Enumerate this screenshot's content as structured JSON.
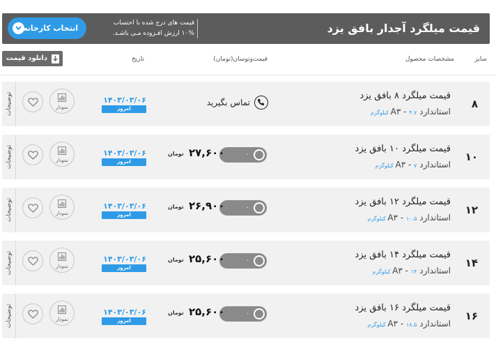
{
  "header": {
    "title": "قیمت میلگرد آجدار بافق یزد",
    "note_line1": "قیمت های درج شده با احتساب",
    "note_line2": "۱۰% ارزش افـزوده مـی باشـد.",
    "factory_button": "انتخاب کارخانه"
  },
  "toolbar": {
    "download_button": "دانلود قیمت"
  },
  "columns": {
    "size": "سایز",
    "specs": "مشخصات محصول",
    "price": "قیمت‌وتوسان(تومان)",
    "date": "تاریخ"
  },
  "labels": {
    "today": "امروز",
    "chart": "نمودار",
    "description": "توضیحات",
    "call": "تماس بگیرید",
    "currency": "تومان",
    "toggle_zero": "۰"
  },
  "rows": [
    {
      "size": "۸",
      "name": "قیمت میلگرد ۸ بافق یزد",
      "standard": "استاندارد A۳ - ",
      "weight": "۴.۷ کیلوگرم",
      "price": null,
      "call": true,
      "date": "۱۴۰۳/۰۳/۰۶"
    },
    {
      "size": "۱۰",
      "name": "قیمت میلگرد ۱۰ بافق یزد",
      "standard": "استاندارد A۳ - ",
      "weight": "۷ کیلوگرم",
      "price": "۲۷,۶۰۰",
      "call": false,
      "date": "۱۴۰۳/۰۳/۰۶"
    },
    {
      "size": "۱۲",
      "name": "قیمت میلگرد ۱۲ بافق یزد",
      "standard": "استاندارد A۳ - ",
      "weight": "۱۰.۵ کیلوگرم",
      "price": "۲۶,۹۰۰",
      "call": false,
      "date": "۱۴۰۳/۰۳/۰۶"
    },
    {
      "size": "۱۴",
      "name": "قیمت میلگرد ۱۴ بافق یزد",
      "standard": "استاندارد A۳ - ",
      "weight": "۱۴ کیلوگرم",
      "price": "۲۵,۶۰۰",
      "call": false,
      "date": "۱۴۰۳/۰۳/۰۶"
    },
    {
      "size": "۱۶",
      "name": "قیمت میلگرد ۱۶ بافق یزد",
      "standard": "استاندارد A۳ - ",
      "weight": "۱۸.۵ کیلوگرم",
      "price": "۲۵,۶۰۰",
      "call": false,
      "date": "۱۴۰۳/۰۳/۰۶"
    }
  ],
  "colors": {
    "accent": "#2f9be6",
    "header_bg": "#5c5c5c",
    "row_bg": "#f1f1f1",
    "toggle_bg": "#8a8a8a"
  }
}
